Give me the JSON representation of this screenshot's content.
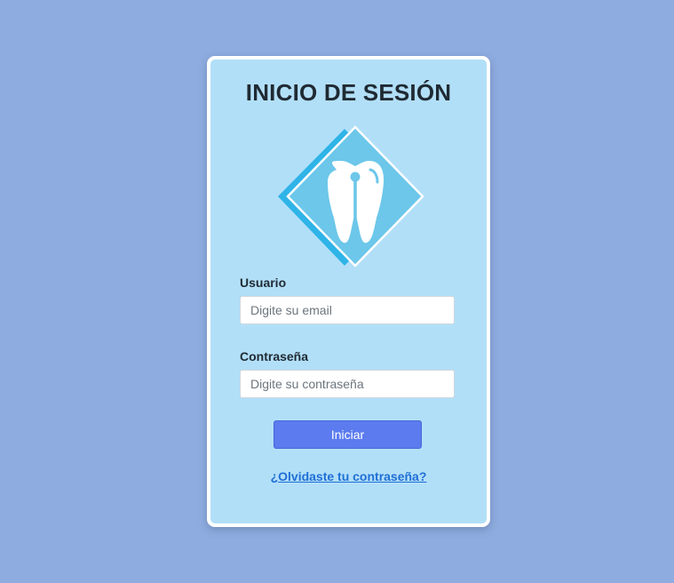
{
  "login": {
    "title": "INICIO DE SESIÓN",
    "logo_icon": "tooth-diamond-icon",
    "user_label": "Usuario",
    "user_placeholder": "Digite su email",
    "user_value": "",
    "password_label": "Contraseña",
    "password_placeholder": "Digite su contraseña",
    "password_value": "",
    "submit_label": "Iniciar",
    "forgot_link": "¿Olvidaste tu contraseña?"
  },
  "colors": {
    "page_background": "#8eacdf",
    "card_background": "#b2dff8",
    "button": "#5b7bef",
    "link": "#1f6fd6",
    "logo_diamond": "#5ec8eb",
    "logo_shadow": "#2fb4e8"
  }
}
